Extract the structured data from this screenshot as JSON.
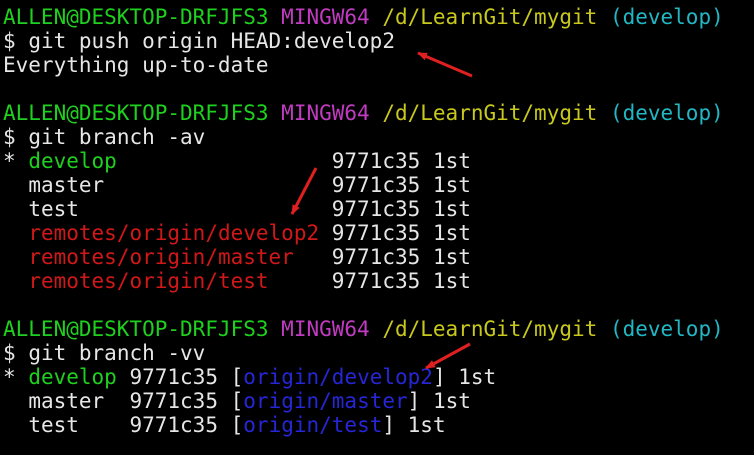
{
  "colors": {
    "background": "#000000",
    "text": "#e6e6e6",
    "green": "#1fd11f",
    "magenta": "#c13bc1",
    "yellow": "#c8c81e",
    "cyan": "#22b7c4",
    "red": "#d11818",
    "blue": "#2626d6",
    "arrow": "#e02020"
  },
  "prompt": {
    "user_host": "ALLEN@DESKTOP-DRFJFS3",
    "system": "MINGW64",
    "path": "/d/LearnGit/mygit",
    "branch": "(develop)",
    "symbol": "$"
  },
  "block1": {
    "command": "git push origin HEAD:develop2",
    "output": "Everything up-to-date"
  },
  "block2": {
    "command": "git branch -av",
    "branches": [
      {
        "marker": "*",
        "name": "develop",
        "hash": "9771c35",
        "msg": "1st"
      },
      {
        "marker": " ",
        "name": "master",
        "hash": "9771c35",
        "msg": "1st"
      },
      {
        "marker": " ",
        "name": "test",
        "hash": "9771c35",
        "msg": "1st"
      },
      {
        "marker": " ",
        "name": "remotes/origin/develop2",
        "hash": "9771c35",
        "msg": "1st"
      },
      {
        "marker": " ",
        "name": "remotes/origin/master",
        "hash": "9771c35",
        "msg": "1st"
      },
      {
        "marker": " ",
        "name": "remotes/origin/test",
        "hash": "9771c35",
        "msg": "1st"
      }
    ]
  },
  "block3": {
    "command": "git branch -vv",
    "branches": [
      {
        "marker": "*",
        "name": "develop",
        "hash": "9771c35",
        "upstream": "origin/develop2",
        "msg": "1st"
      },
      {
        "marker": " ",
        "name": "master",
        "hash": "9771c35",
        "upstream": "origin/master",
        "msg": "1st"
      },
      {
        "marker": " ",
        "name": "test",
        "hash": "9771c35",
        "upstream": "origin/test",
        "msg": "1st"
      }
    ]
  }
}
